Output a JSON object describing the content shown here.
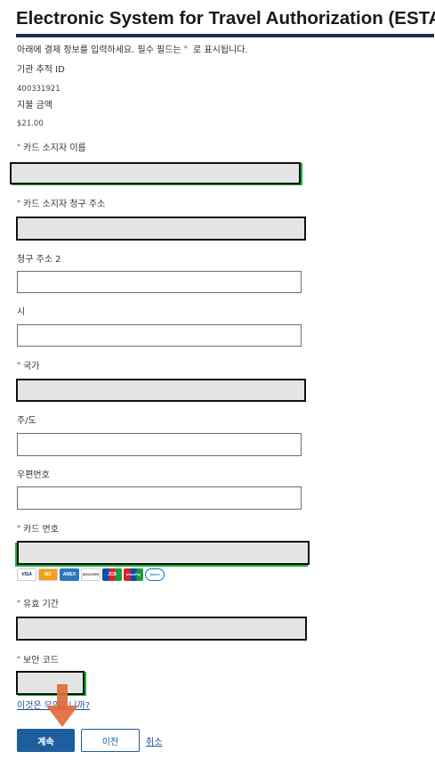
{
  "header": {
    "title": "Electronic System for Travel Authorization (ESTA)"
  },
  "intro": {
    "text_before": "아래에 결제 정보를 입력하세요. 필수 필드는 ",
    "star": "*",
    "text_after": " 로 표시됩니다."
  },
  "tracking": {
    "label": "기관 추적 ID",
    "value": "400331921"
  },
  "payment": {
    "label": "지불 금액",
    "value": "$21.00"
  },
  "required_marker": "*",
  "fields": {
    "cardholder_name": {
      "label": "카드 소지자 이름",
      "value": ""
    },
    "billing_address": {
      "label": "카드 소지자 청구 주소",
      "value": ""
    },
    "billing_address2": {
      "label": "청구 주소 2",
      "value": ""
    },
    "city": {
      "label": "시",
      "value": ""
    },
    "country": {
      "label": "국가",
      "value": ""
    },
    "state": {
      "label": "주/도",
      "value": ""
    },
    "postal_code": {
      "label": "우편번호",
      "value": ""
    },
    "card_number": {
      "label": "카드 번호",
      "value": ""
    },
    "expiration": {
      "label": "유효 기간",
      "value": ""
    },
    "security_code": {
      "label": "보안 코드",
      "value": ""
    }
  },
  "card_logos": [
    {
      "name": "VISA",
      "color": "#ffffff",
      "text": "#1a1f71"
    },
    {
      "name": "MC",
      "color": "#ffffff",
      "text": "#eb001b"
    },
    {
      "name": "AMEX",
      "color": "#2e77bb",
      "text": "#ffffff"
    },
    {
      "name": "DISCOVER",
      "color": "#ffffff",
      "text": "#333333"
    },
    {
      "name": "JCB",
      "color": "#ffffff",
      "text": "#0b4ea2"
    },
    {
      "name": "UnionPay",
      "color": "#d8232a",
      "text": "#ffffff"
    },
    {
      "name": "Diners",
      "color": "#ffffff",
      "text": "#0079be"
    }
  ],
  "help_link": "이것은 무엇입니까?",
  "buttons": {
    "continue": "계속",
    "previous": "이전",
    "cancel": "취소"
  },
  "colors": {
    "primary": "#1c5e9e",
    "header_rule": "#1b2d52",
    "arrow": "#e06b3c"
  }
}
